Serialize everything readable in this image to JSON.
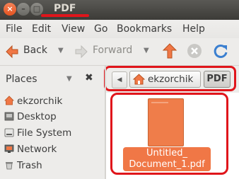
{
  "window": {
    "title": "PDF",
    "close_glyph": "×",
    "min_glyph": "–",
    "max_glyph": "□",
    "accent": "#e0151b"
  },
  "menubar": {
    "items": [
      "File",
      "Edit",
      "View",
      "Go",
      "Bookmarks",
      "Help"
    ]
  },
  "toolbar": {
    "back_label": "Back",
    "forward_label": "Forward",
    "back_icon": "arrow-left-icon",
    "forward_icon": "arrow-right-icon",
    "up_icon": "arrow-up-icon",
    "stop_icon": "stop-icon",
    "reload_icon": "reload-icon"
  },
  "places": {
    "title": "Places",
    "close_glyph": "✖",
    "items": [
      "ekzorchik",
      "Desktop",
      "File System",
      "Network",
      "Trash"
    ]
  },
  "pathbar": {
    "back_glyph": "◀",
    "home_label": "ekzorchik",
    "current_label": "PDF"
  },
  "files": {
    "item_name_line1": "Untitled_",
    "item_name_line2": "Document_1.pdf"
  }
}
